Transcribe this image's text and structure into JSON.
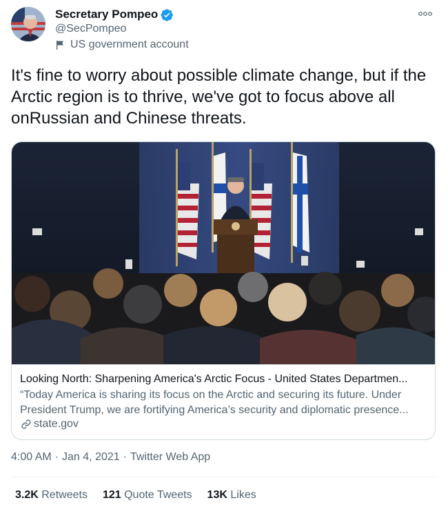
{
  "author": {
    "name": "Secretary Pompeo",
    "handle": "@SecPompeo",
    "label": "US government account",
    "verified_color": "#1d9bf0"
  },
  "icons": {
    "more": "more-options-icon",
    "verified": "verified-badge-icon",
    "flag": "government-flag-icon",
    "link": "link-icon"
  },
  "tweet": {
    "text": "It's fine to worry about possible climate change, but if the Arctic region is to thrive, we've got to focus above all onRussian and Chinese threats."
  },
  "card": {
    "title": "Looking North: Sharpening America's Arctic Focus - United States Departmen...",
    "description_line1": "“Today America is sharing its focus on the Arctic and securing its future. Under",
    "description_line2": "President Trump, we are fortifying America’s security and diplomatic presence...",
    "domain": "state.gov"
  },
  "meta": {
    "time": "4:00 AM",
    "sep1": "·",
    "date": "Jan 4, 2021",
    "sep2": "·",
    "source": "Twitter Web App"
  },
  "stats": {
    "retweets_count": "3.2K",
    "retweets_label": "Retweets",
    "quotes_count": "121",
    "quotes_label": "Quote Tweets",
    "likes_count": "13K",
    "likes_label": "Likes"
  }
}
